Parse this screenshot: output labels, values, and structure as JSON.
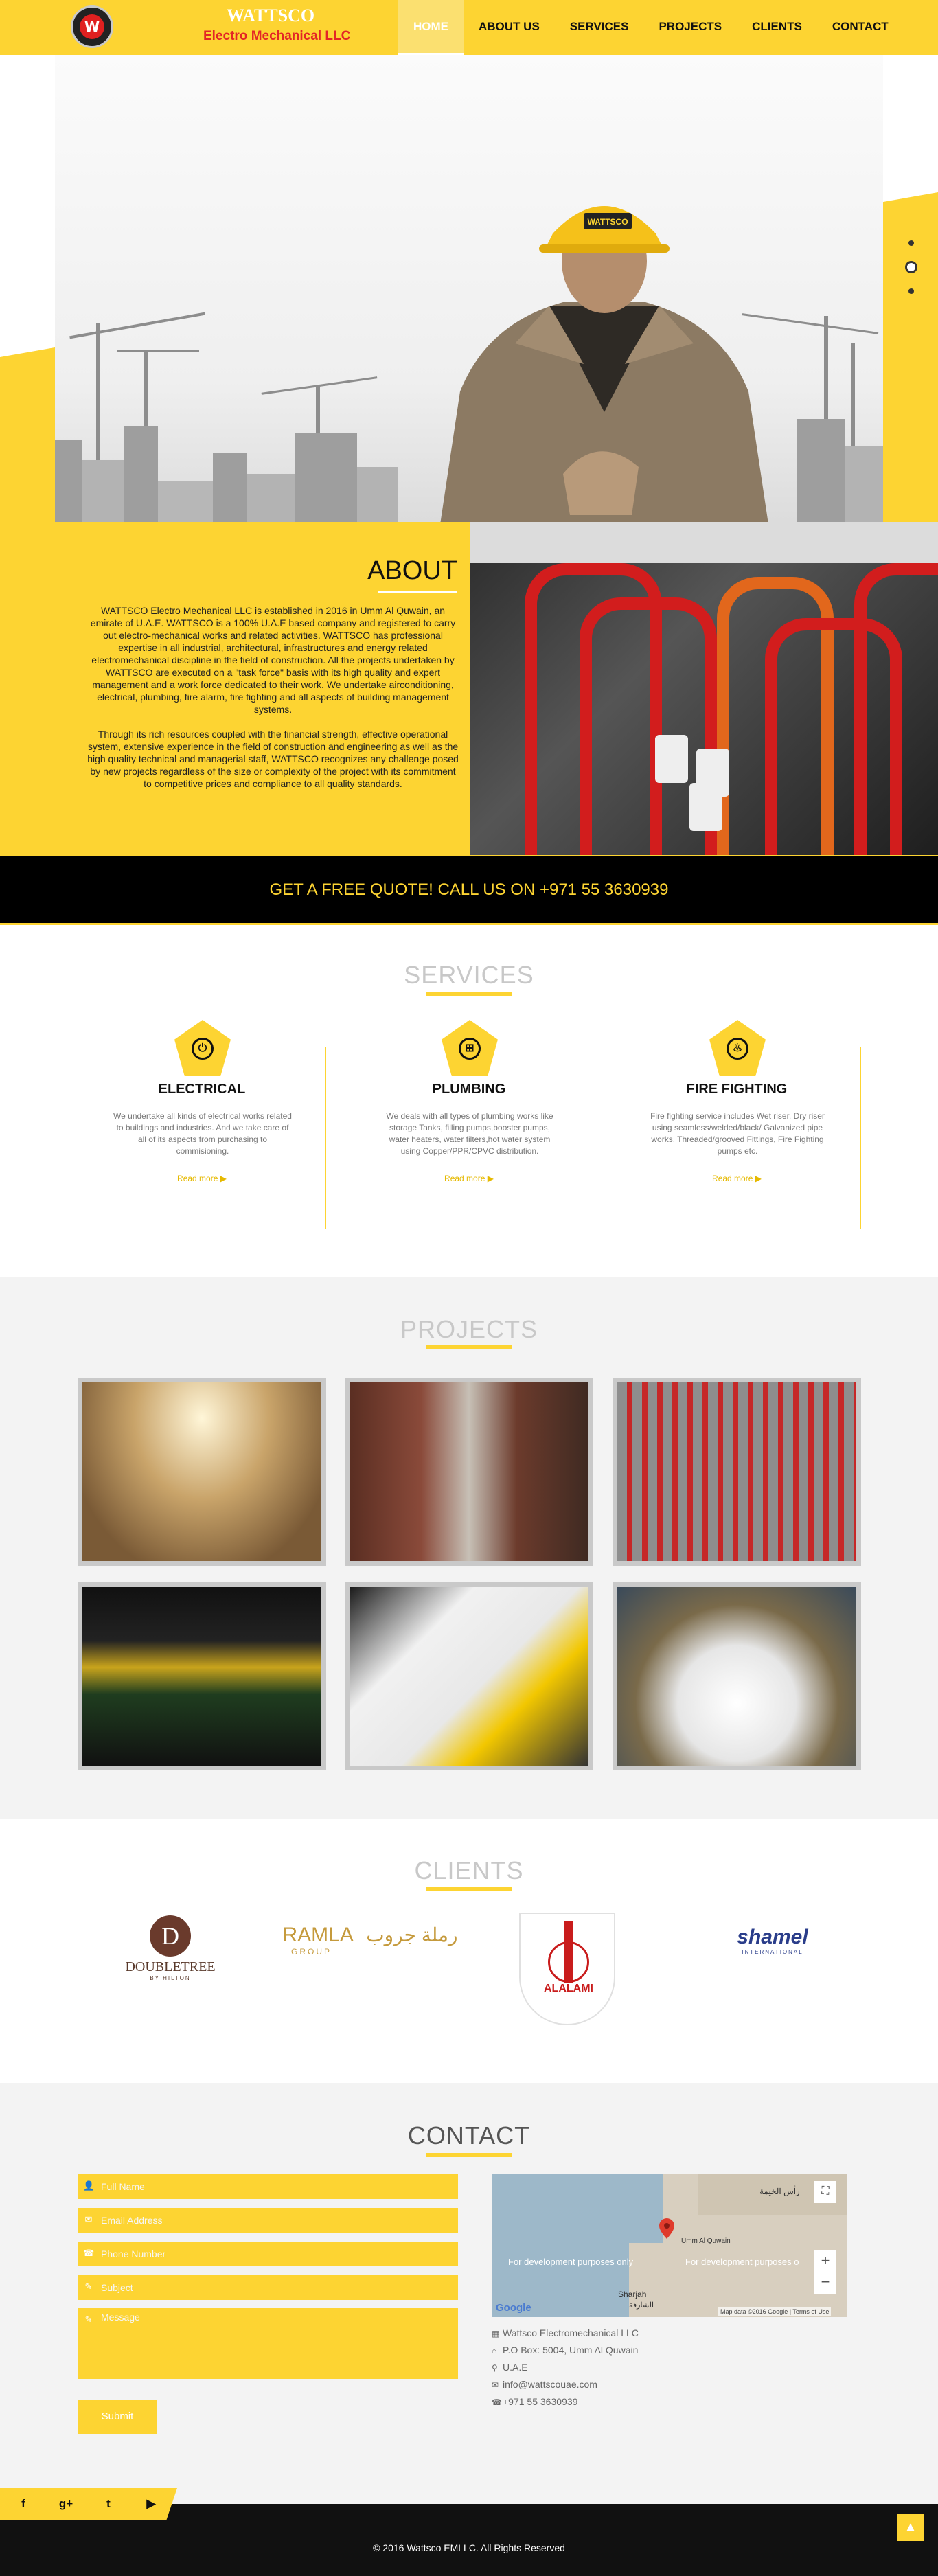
{
  "header": {
    "logo_letter": "W",
    "brand_name": "WATTSCO",
    "brand_subtitle": "Electro Mechanical LLC",
    "nav": [
      {
        "label": "HOME",
        "active": true
      },
      {
        "label": "ABOUT US",
        "active": false
      },
      {
        "label": "SERVICES",
        "active": false
      },
      {
        "label": "PROJECTS",
        "active": false
      },
      {
        "label": "CLIENTS",
        "active": false
      },
      {
        "label": "CONTACT",
        "active": false
      }
    ]
  },
  "hero": {
    "helmet_text": "WATTSCO",
    "slides_total": 3,
    "active_slide": 2
  },
  "about": {
    "title": "ABOUT",
    "paragraphs": [
      "WATTSCO Electro Mechanical LLC is established in 2016 in Umm Al Quwain, an emirate of U.A.E. WATTSCO is a 100% U.A.E based company and registered to carry out electro-mechanical works and related activities. WATTSCO has professional expertise in all industrial, architectural, infrastructures and energy related electromechanical discipline in the field of construction. All the projects undertaken by WATTSCO are executed on a \"task force\" basis with its high quality and expert management and a work force dedicated to their work. We undertake airconditioning, electrical, plumbing, fire alarm, fire fighting and all aspects of building management systems.",
      "Through its rich resources coupled with the financial strength, effective operational system, extensive experience in the field of construction and engineering as well as the high quality technical and managerial staff, WATTSCO recognizes any challenge posed by new projects regardless of the size or complexity of the project with its commitment to competitive prices and compliance to all quality standards."
    ]
  },
  "quote": {
    "text": "GET A FREE QUOTE! CALL US ON +971 55 3630939"
  },
  "services": {
    "title": "SERVICES",
    "items": [
      {
        "name": "ELECTRICAL",
        "icon": "plug-icon",
        "glyph": "⏻",
        "description": "We undertake all kinds of electrical works related to buildings and industries. And we take care of all of its aspects from purchasing to commisioning.",
        "more": "Read more ▶"
      },
      {
        "name": "PLUMBING",
        "icon": "pipe-icon",
        "glyph": "⊞",
        "description": "We deals with all types of plumbing works like storage Tanks, filling pumps,booster pumps, water heaters, water filters,hot water system using Copper/PPR/CPVC distribution.",
        "more": "Read more ▶"
      },
      {
        "name": "FIRE FIGHTING",
        "icon": "fire-extinguisher-icon",
        "glyph": "♨",
        "description": "Fire fighting service includes Wet riser, Dry riser using seamless/welded/black/ Galvanized pipe works, Threaded/grooved Fittings, Fire Fighting pumps etc.",
        "more": "Read more ▶"
      }
    ]
  },
  "projects": {
    "title": "PROJECTS"
  },
  "clients": {
    "title": "CLIENTS",
    "items": [
      {
        "name": "DOUBLETREE",
        "sub": "BY HILTON"
      },
      {
        "name": "RAMLA",
        "sub": "GROUP",
        "arabic": "رملة جروب"
      },
      {
        "name": "ALALAMI",
        "sub": ""
      },
      {
        "name": "shamel",
        "sub": "INTERNATIONAL"
      }
    ]
  },
  "contact": {
    "title": "CONTACT",
    "fields": [
      {
        "placeholder": "Full Name",
        "icon": "user-icon",
        "glyph": "👤"
      },
      {
        "placeholder": "Email Address",
        "icon": "envelope-icon",
        "glyph": "✉"
      },
      {
        "placeholder": "Phone Number",
        "icon": "phone-icon",
        "glyph": "☎"
      },
      {
        "placeholder": "Subject",
        "icon": "pencil-icon",
        "glyph": "✎"
      },
      {
        "placeholder": "Message",
        "icon": "edit-icon",
        "glyph": "✎"
      }
    ],
    "submit_label": "Submit",
    "map": {
      "dev_text_left": "For development purposes only",
      "dev_text_right": "For development purposes o",
      "google": "Google",
      "attribution": "Map data ©2016 Google",
      "terms": "Terms of Use",
      "city_sharjah": "Sharjah",
      "city_sharjah_ar": "الشارقة",
      "city_ras_ar": "رأس الخيمة",
      "city_uaq": "Umm Al Quwain"
    },
    "address": [
      {
        "icon": "building-icon",
        "glyph": "▦",
        "text": "Wattsco Electromechanical LLC"
      },
      {
        "icon": "home-icon",
        "glyph": "⌂",
        "text": "P.O Box: 5004, Umm Al Quwain"
      },
      {
        "icon": "map-pin-icon",
        "glyph": "⚲",
        "text": "U.A.E"
      },
      {
        "icon": "envelope-icon",
        "glyph": "✉",
        "text": "info@wattscouae.com"
      },
      {
        "icon": "phone-icon",
        "glyph": "☎",
        "text": "+971 55 3630939"
      }
    ]
  },
  "social": [
    {
      "name": "facebook-icon",
      "glyph": "f"
    },
    {
      "name": "google-plus-icon",
      "glyph": "g+"
    },
    {
      "name": "twitter-icon",
      "glyph": "t"
    },
    {
      "name": "youtube-icon",
      "glyph": "▶"
    }
  ],
  "footer": {
    "copyright": "© 2016 Wattsco EMLLC. All Rights Reserved",
    "to_top": "▲"
  }
}
